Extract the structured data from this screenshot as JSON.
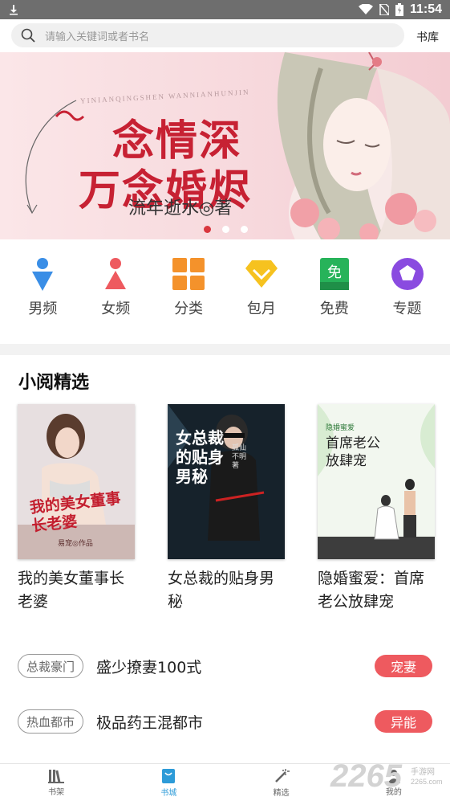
{
  "status_bar": {
    "time": "11:54"
  },
  "search": {
    "placeholder": "请输入关键词或者书名",
    "shelf_link": "书库"
  },
  "banner": {
    "pinyin": "YINIANQINGSHEN WANNIANHUNJIN",
    "title_line1": "念情深",
    "title_line2": "万念婚烬",
    "author": "流年逝水◎著",
    "page_count": 3,
    "active_page": 1
  },
  "categories": [
    {
      "label": "男频",
      "icon": "male-icon",
      "color": "#3a8ee6"
    },
    {
      "label": "女频",
      "icon": "female-icon",
      "color": "#ee5a5f"
    },
    {
      "label": "分类",
      "icon": "grid-icon",
      "color": "#f4922b"
    },
    {
      "label": "包月",
      "icon": "diamond-icon",
      "color": "#f6c21f"
    },
    {
      "label": "免费",
      "icon": "free-icon",
      "color": "#27b35a"
    },
    {
      "label": "专题",
      "icon": "pentagon-icon",
      "color": "#8a4be0"
    }
  ],
  "section": {
    "title": "小阅精选"
  },
  "books": [
    {
      "title": "我的美女董事长老婆",
      "cover_text": "我的美女董事长老婆",
      "cover_sub": "易宠◎作品"
    },
    {
      "title": "女总裁的贴身男秘",
      "cover_text": "女总裁的贴身男秘",
      "cover_sub": "孤仙不明 著"
    },
    {
      "title": "隐婚蜜爱：首席老公放肆宠",
      "cover_text": "首席老公放肆宠",
      "cover_sub": "隐婚蜜爱"
    }
  ],
  "recommendations": [
    {
      "tag": "总裁豪门",
      "name": "盛少撩妻100式",
      "badge": "宠妻"
    },
    {
      "tag": "热血都市",
      "name": "极品药王混都市",
      "badge": "异能"
    }
  ],
  "bottom_nav": [
    {
      "label": "书架",
      "icon": "bookshelf-icon",
      "active": false
    },
    {
      "label": "书城",
      "icon": "store-icon",
      "active": true
    },
    {
      "label": "精选",
      "icon": "wand-icon",
      "active": false
    },
    {
      "label": "我的",
      "icon": "profile-icon",
      "active": false
    }
  ],
  "watermark": {
    "brand": "2265",
    "text": "手游网",
    "url": "2265.com"
  },
  "colors": {
    "accent": "#2d9bd8",
    "badge": "#ee5a5f",
    "banner_title": "#c72133"
  }
}
